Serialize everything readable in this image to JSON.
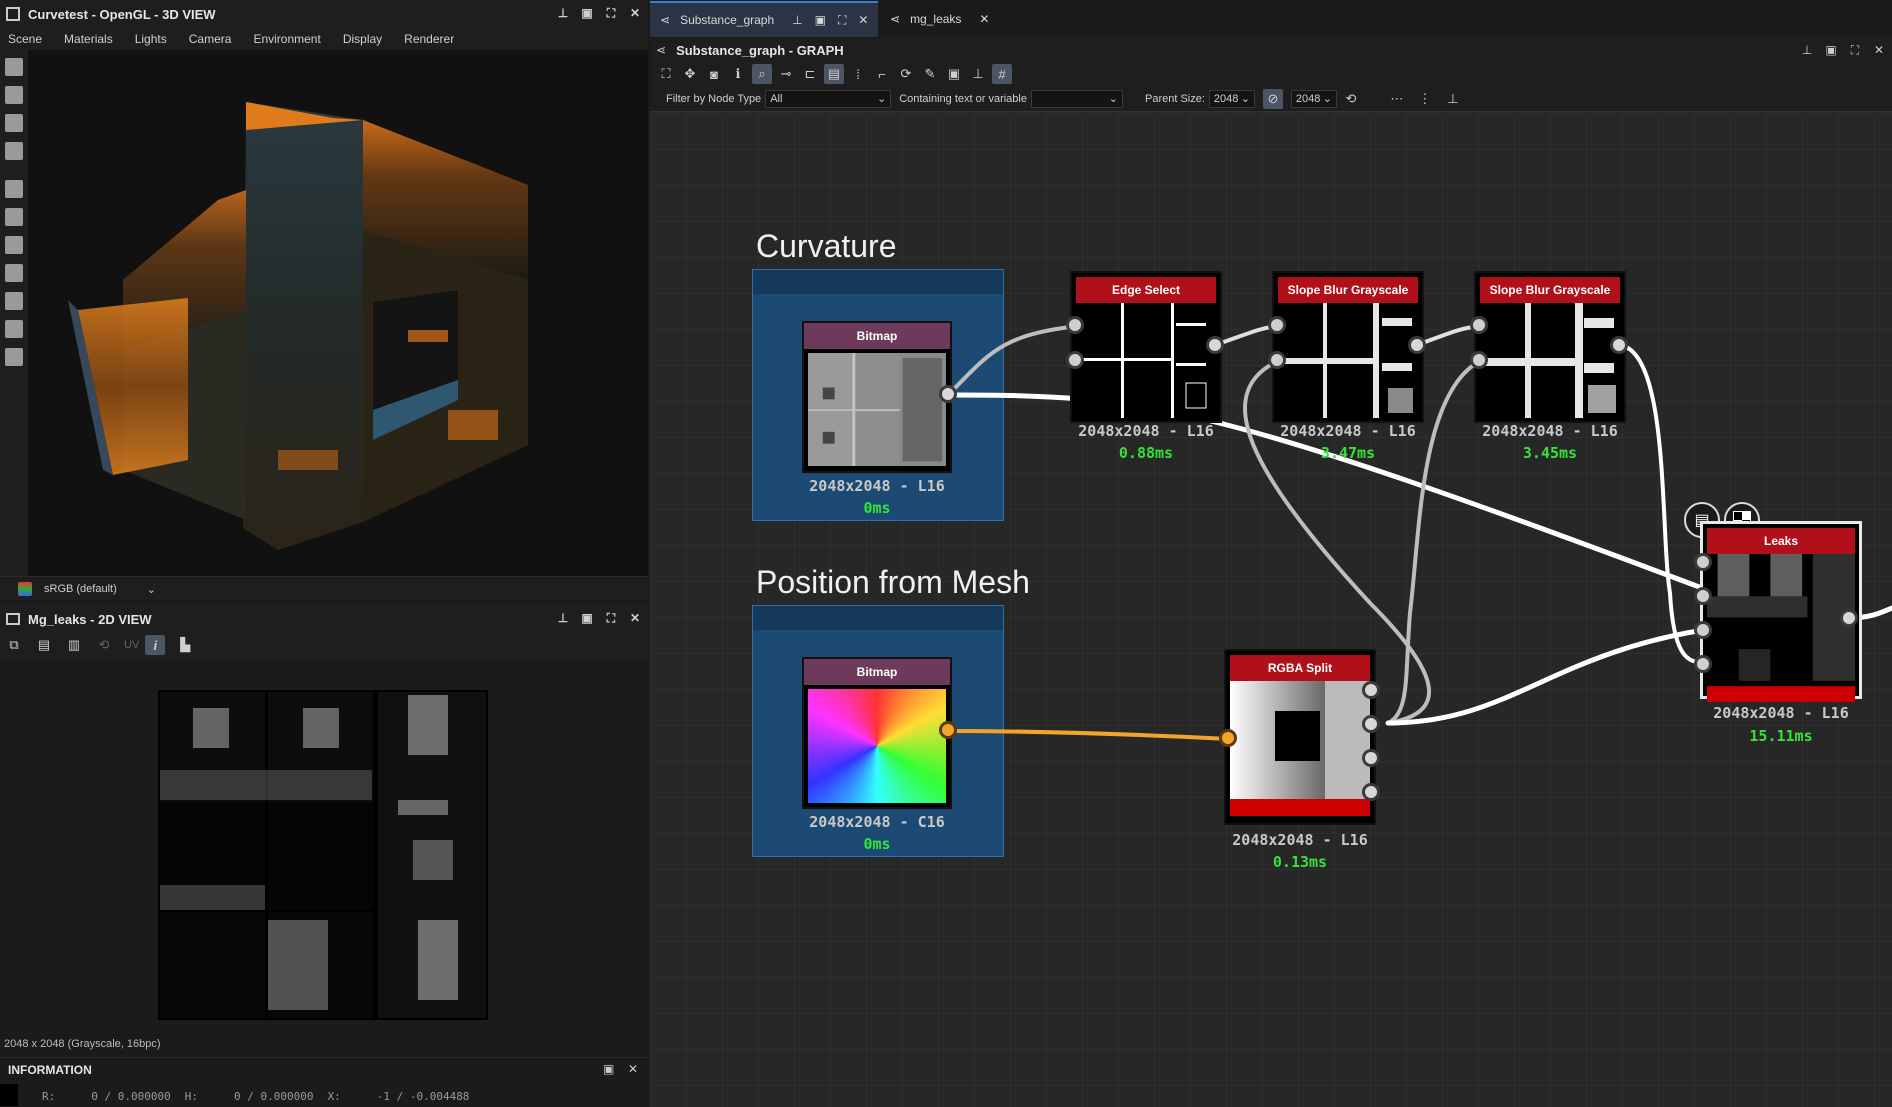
{
  "view3d": {
    "title": "Curvetest - OpenGL - 3D VIEW",
    "menu": [
      "Scene",
      "Materials",
      "Lights",
      "Camera",
      "Environment",
      "Display",
      "Renderer"
    ],
    "colorspace": "sRGB (default)"
  },
  "view2d": {
    "title": "Mg_leaks - 2D VIEW",
    "uv_label": "UV",
    "status": "2048 x 2048 (Grayscale, 16bpc)"
  },
  "info": {
    "title": "INFORMATION",
    "r_label": "R:",
    "r_value": "0 / 0.000000",
    "h_label": "H:",
    "h_value": "0 / 0.000000",
    "x_label": "X:",
    "x_value": "-1 / -0.004488"
  },
  "graph": {
    "tabs": [
      "Substance_graph",
      "mg_leaks"
    ],
    "title": "Substance_graph - GRAPH",
    "filter_label": "Filter by Node Type",
    "filter_value": "All",
    "containing_label": "Containing text or variable",
    "containing_value": "",
    "parent_size_label": "Parent Size:",
    "parent_size_1": "2048",
    "parent_size_2": "2048"
  },
  "frames": [
    {
      "title": "Curvature"
    },
    {
      "title": "Position from Mesh"
    }
  ],
  "nodes": {
    "bitmap1": {
      "name": "Bitmap",
      "res": "2048x2048 - L16",
      "time": "0ms"
    },
    "bitmap2": {
      "name": "Bitmap",
      "res": "2048x2048 - C16",
      "time": "0ms"
    },
    "edge": {
      "name": "Edge Select",
      "res": "2048x2048 - L16",
      "time": "0.88ms"
    },
    "slope1": {
      "name": "Slope Blur Grayscale",
      "res": "2048x2048 - L16",
      "time": "3.47ms"
    },
    "slope2": {
      "name": "Slope Blur Grayscale",
      "res": "2048x2048 - L16",
      "time": "3.45ms"
    },
    "rgba": {
      "name": "RGBA Split",
      "res": "2048x2048 - L16",
      "time": "0.13ms"
    },
    "leaks": {
      "name": "Leaks",
      "res": "2048x2048 - L16",
      "time": "15.11ms"
    }
  },
  "colors": {
    "node_header_red": "#b0101a",
    "bitmap_header": "#6e3a5c",
    "frame_blue": "#1c4a72",
    "time_green": "#36e23a",
    "orange_wire": "#f2a52a"
  }
}
